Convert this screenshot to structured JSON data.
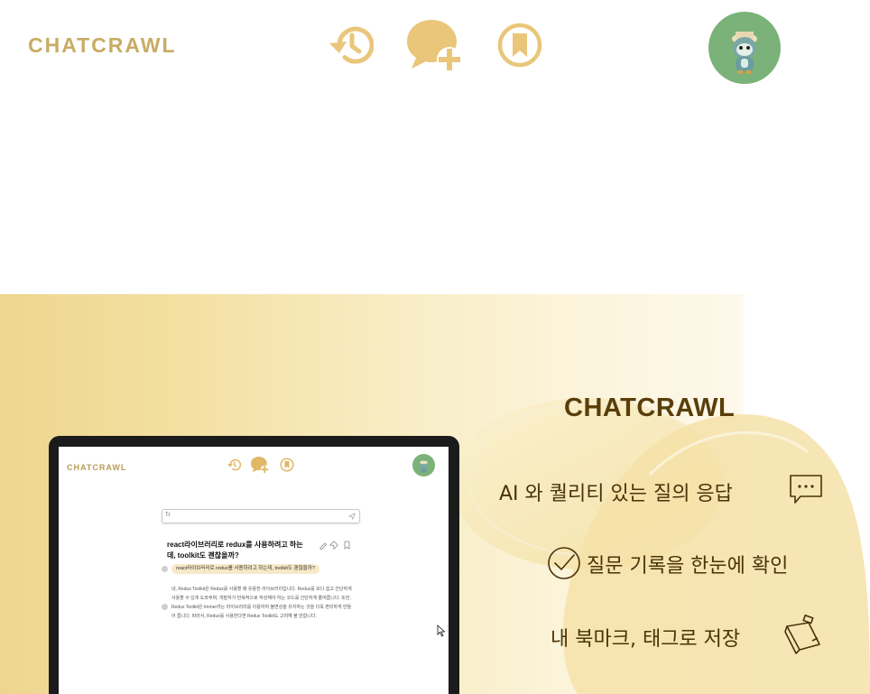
{
  "header": {
    "brand": "CHATCRAWL",
    "nav": [
      "history-icon",
      "new-chat-icon",
      "bookmark-icon"
    ],
    "avatar": "owl-avatar"
  },
  "hero": {
    "preview": {
      "brand": "CHATCRAWL",
      "search_placeholder": "Tr",
      "question": "react라이브러리로 redux를 사용하려고 하는데, toolkit도 괜찮을까?",
      "chip": "react라이브러리로 redux를 사용하려고 하는데, toolkit도 괜찮을까?",
      "answer": "네, Redux Toolkit은 Redux를 사용할 때 유용한 라이브러리입니다. Redux를 보다 쉽고 간단하게 사용할 수 있게 도와주며, 개발자가 반복적으로 작성해야 하는 코드를 간단하게 줄여줍니다. 또한, Redux Toolkit은 Immer라는 라이브러리를 이용하여 불변성을 유지하는 것을 더욱 편리하게 만들어 줍니다. 따라서, Redux를 사용한다면 Redux Toolkit도 고려해 볼 만합니다."
    },
    "title": "CHATCRAWL",
    "features": [
      {
        "text": "AI 와 퀄리티 있는 질의 응답",
        "icon": "speech-bubble-icon"
      },
      {
        "text": "질문 기록을 한눈에 확인",
        "icon": "check-circle-icon"
      },
      {
        "text": "내 북마크, 태그로 저장",
        "icon": "sticky-note-icon"
      }
    ]
  },
  "colors": {
    "accent": "#e9c67a",
    "brand_text": "#c8ac63",
    "feature_text": "#4b3208",
    "avatar_bg": "#7bb27a"
  }
}
